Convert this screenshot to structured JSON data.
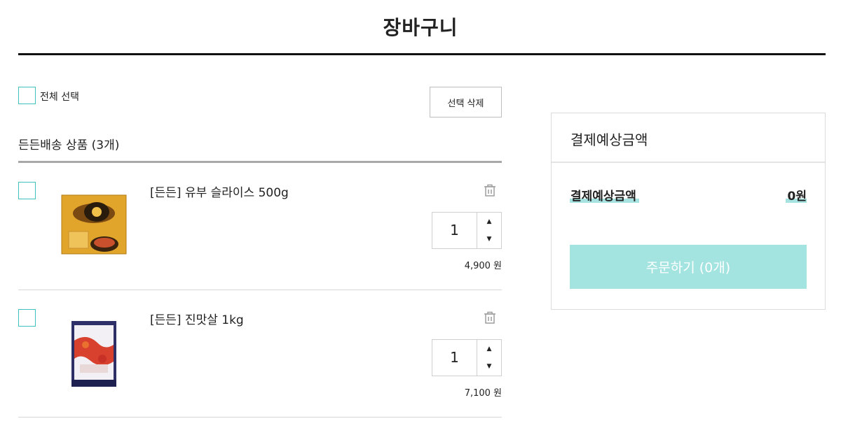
{
  "page": {
    "title": "장바구니"
  },
  "cart": {
    "select_all_label": "전체 선택",
    "delete_selected_label": "선택 삭제",
    "group_title": "든든배송 상품 (3개)",
    "items": [
      {
        "name": "[든든] 유부 슬라이스 500g",
        "quantity": "1",
        "price": "4,900 원",
        "thumb_icon": "product-yubu-package-icon"
      },
      {
        "name": "[든든] 진맛살 1kg",
        "quantity": "1",
        "price": "7,100 원",
        "thumb_icon": "product-crabstick-package-icon"
      }
    ]
  },
  "summary": {
    "header": "결제예상금액",
    "label": "결제예상금액",
    "amount": "0원",
    "order_button": "주문하기 (0개)"
  },
  "colors": {
    "accent": "#3fc1c0",
    "order_button": "#a3e3e0",
    "highlight": "#a6e3e0",
    "rule_dark": "#111111"
  }
}
